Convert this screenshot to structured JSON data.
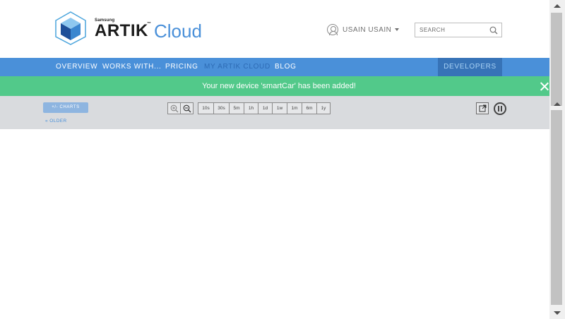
{
  "brand": {
    "samsung": "Samsung",
    "artik": "ARTIK",
    "tm": "™",
    "cloud": "Cloud",
    "logo_icon": "cube-logo-icon"
  },
  "user": {
    "name": "USAIN USAIN",
    "icon": "user-icon",
    "caret_icon": "caret-down-icon"
  },
  "search": {
    "placeholder": "SEARCH",
    "icon": "search-icon"
  },
  "nav": {
    "items": [
      {
        "label": "OVERVIEW"
      },
      {
        "label": "WORKS WITH..."
      },
      {
        "label": "PRICING"
      },
      {
        "label": "MY ARTIK CLOUD",
        "active": true
      },
      {
        "label": "BLOG"
      }
    ],
    "developers": "DEVELOPERS"
  },
  "notice": {
    "message": "Your new device 'smartCar' has been added!",
    "close_icon": "close-icon"
  },
  "toolbar": {
    "charts_button": "+/- CHARTS",
    "older_link": "« OLDER",
    "zoom_in_icon": "zoom-in-icon",
    "zoom_out_icon": "zoom-out-icon",
    "time_ranges": [
      "10s",
      "30s",
      "5m",
      "1h",
      "1d",
      "1w",
      "1m",
      "6m",
      "1y"
    ],
    "export_icon": "export-icon",
    "pause_icon": "pause-icon"
  },
  "colors": {
    "nav_bg": "#4a90d9",
    "developers_bg": "#3773b7",
    "notice_bg": "#52c98a",
    "toolbar_bg": "#d9dbde",
    "brand_blue": "#4a90d9"
  }
}
